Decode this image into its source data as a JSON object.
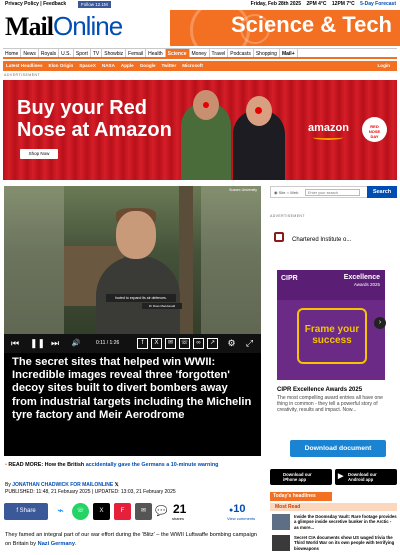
{
  "topbar": {
    "privacy": "Privacy Policy",
    "feedback": "Feedback",
    "follow": "Follow 12.1M",
    "date": "Friday, Feb 28th 2025",
    "time_weather": "2PM 4°C",
    "weather2": "12PM 7°C",
    "forecast": "5-Day Forecast"
  },
  "logo": {
    "mail": "Mail",
    "online": "Online"
  },
  "section_title": "Science & Tech",
  "nav": {
    "items": [
      "Home",
      "News",
      "Royals",
      "U.S.",
      "Sport",
      "TV",
      "Showbiz",
      "Femail",
      "Health",
      "Science",
      "Money",
      "Travel",
      "Podcasts",
      "Shopping",
      "Mail+"
    ],
    "active": "Science"
  },
  "subnav": {
    "items": [
      "Latest Headlines",
      "Elon Origin",
      "SpaceX",
      "NASA",
      "Apple",
      "Google",
      "Twitter",
      "Microsoft"
    ],
    "login": "Login"
  },
  "ad_label": "ADVERTISEMENT",
  "ad": {
    "headline": "Buy your Red Nose at Amazon",
    "cta": "Shop Now",
    "brand": "amazon",
    "roundel": [
      "RED",
      "NOSE",
      "DAY"
    ]
  },
  "video": {
    "source": "Sussex University",
    "caption1": "footed to expand its air defences.",
    "caption2": "Dr Ross Macdonald",
    "time": "0:11 / 1:26"
  },
  "article": {
    "title": "The secret sites that helped win WWII: Incredible images reveal three 'forgotten' decoy sites built to divert bombers away from industrial targets including the Michelin tyre factory and Meir Aerodrome",
    "readmore_label": "READ MORE:",
    "readmore_pre": "How the British",
    "readmore_link": "accidentally gave the Germans a 10-minute warning",
    "by": "By",
    "author": "JONATHAN CHADWICK FOR MAILONLINE",
    "published": "PUBLISHED: 11:48, 21 February 2025",
    "updated": "UPDATED: 13:03, 21 February 2025",
    "share_label": "Share",
    "shares": "21",
    "shares_label": "shares",
    "comments": "10",
    "comments_label": "View comments",
    "body_pre": "They famed an integral part of our war effort during the 'Blitz' – the WWII Luftwaffe bombing campaign on Britain by",
    "body_link": "Nazi Germany",
    "body_post": "."
  },
  "search": {
    "opt1": "Site",
    "opt2": "Web",
    "placeholder": "Enter your search",
    "button": "Search"
  },
  "sidebar": {
    "ad_label": "ADVERTISEMENT",
    "chartered": "Chartered Institute o...",
    "cipr_logo": "CIPR",
    "cipr_excellence": "Excellence",
    "cipr_awards": "Awards 2025",
    "cipr_tagline": "Frame your success",
    "cipr_title": "CIPR Excellence Awards 2025",
    "cipr_desc": "The most compelling award entries all have one thing in common - they tell a powerful story of creativity, results and impact. Now...",
    "download": "Download document",
    "app1_top": "Download our",
    "app1_bottom": "iPhone app",
    "app2_top": "Download our",
    "app2_bottom": "Android app",
    "todays": "Today's headlines",
    "most_read": "Most Read",
    "headlines": [
      "Inside the Doomsday Vault: Rare footage provides a glimpse inside secretive bunker in the Arctic - as more...",
      "Secret CIA documents show US waged trivia the Third World War on its own people with terrifying bioweapons"
    ]
  },
  "colors": {
    "accent": "#f36f21",
    "link": "#004db3",
    "ad_red": "#c8141e"
  }
}
